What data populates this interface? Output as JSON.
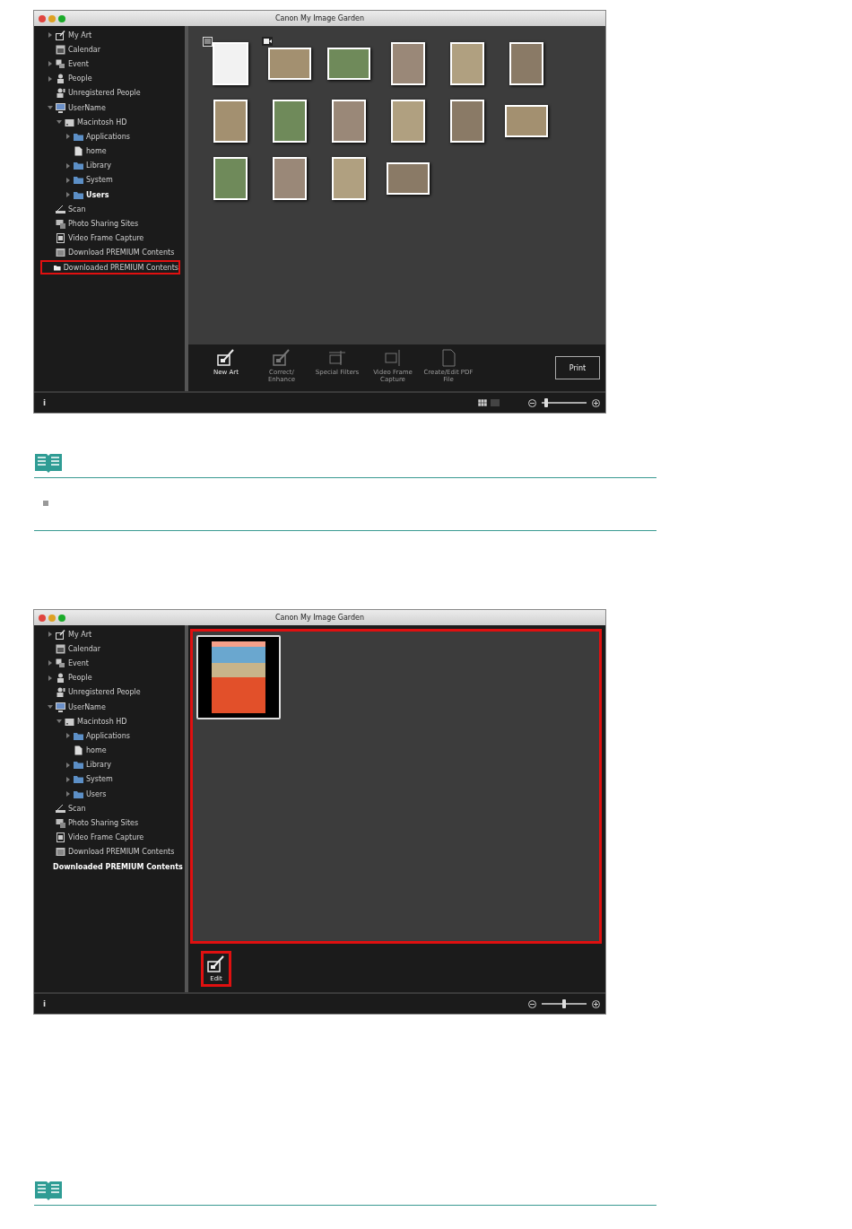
{
  "windows": [
    {
      "title": "Canon My Image Garden",
      "sidebar": {
        "items": [
          {
            "label": "My Art",
            "kind": "art",
            "expandable": true,
            "expanded": false,
            "selected": false,
            "highlighted": false
          },
          {
            "label": "Calendar",
            "kind": "calendar",
            "expandable": false,
            "selected": false,
            "highlighted": false
          },
          {
            "label": "Event",
            "kind": "event",
            "expandable": true,
            "expanded": false,
            "selected": false,
            "highlighted": false
          },
          {
            "label": "People",
            "kind": "people",
            "expandable": true,
            "expanded": false,
            "selected": false,
            "highlighted": false
          },
          {
            "label": "Unregistered People",
            "kind": "unregistered",
            "expandable": false,
            "selected": false,
            "highlighted": false
          },
          {
            "label": "UserName",
            "kind": "computer",
            "expandable": true,
            "expanded": true,
            "selected": false,
            "highlighted": false,
            "children": [
              {
                "label": "Macintosh HD",
                "kind": "disk",
                "expandable": true,
                "expanded": true,
                "selected": false,
                "highlighted": false,
                "children": [
                  {
                    "label": "Applications",
                    "kind": "folder",
                    "expandable": true,
                    "expanded": false,
                    "selected": false,
                    "highlighted": false
                  },
                  {
                    "label": "home",
                    "kind": "document",
                    "expandable": false,
                    "selected": false,
                    "highlighted": false
                  },
                  {
                    "label": "Library",
                    "kind": "folder",
                    "expandable": true,
                    "expanded": false,
                    "selected": false,
                    "highlighted": false
                  },
                  {
                    "label": "System",
                    "kind": "folder",
                    "expandable": true,
                    "expanded": false,
                    "selected": false,
                    "highlighted": false
                  },
                  {
                    "label": "Users",
                    "kind": "folder",
                    "expandable": true,
                    "expanded": false,
                    "selected": true,
                    "highlighted": false
                  }
                ]
              }
            ]
          },
          {
            "label": "Scan",
            "kind": "scan",
            "expandable": false,
            "selected": false,
            "highlighted": false
          },
          {
            "label": "Photo Sharing Sites",
            "kind": "sharing",
            "expandable": false,
            "selected": false,
            "highlighted": false
          },
          {
            "label": "Video Frame Capture",
            "kind": "video",
            "expandable": false,
            "selected": false,
            "highlighted": false
          },
          {
            "label": "Download PREMIUM Contents",
            "kind": "download",
            "expandable": false,
            "selected": false,
            "highlighted": false
          },
          {
            "label": "Downloaded PREMIUM Contents",
            "kind": "downloaded",
            "expandable": false,
            "selected": false,
            "highlighted": true
          }
        ]
      },
      "content": {
        "highlighted": false,
        "thumbnails": [
          {
            "kind": "document",
            "selected": false
          },
          {
            "kind": "video",
            "selected": false
          },
          {
            "kind": "wide",
            "selected": false
          },
          {
            "kind": "photo",
            "selected": false
          },
          {
            "kind": "photo",
            "selected": false
          },
          {
            "kind": "photo",
            "selected": false
          },
          {
            "kind": "photo",
            "selected": false
          },
          {
            "kind": "photo",
            "selected": false
          },
          {
            "kind": "photo",
            "selected": false
          },
          {
            "kind": "photo",
            "selected": false
          },
          {
            "kind": "photo",
            "selected": false
          },
          {
            "kind": "wide",
            "selected": false
          },
          {
            "kind": "photo",
            "selected": false
          },
          {
            "kind": "photo",
            "selected": false
          },
          {
            "kind": "photo",
            "selected": false
          },
          {
            "kind": "wide",
            "selected": false
          }
        ]
      },
      "toolbar": {
        "buttons": [
          {
            "label": "New Art",
            "kind": "art",
            "disabled": false,
            "highlighted": false
          },
          {
            "label": "Correct/ Enhance",
            "kind": "correct",
            "disabled": true,
            "highlighted": false
          },
          {
            "label": "Special Filters",
            "kind": "filters",
            "disabled": true,
            "highlighted": false
          },
          {
            "label": "Video Frame Capture",
            "kind": "video",
            "disabled": true,
            "highlighted": false
          },
          {
            "label": "Create/Edit PDF File",
            "kind": "pdf",
            "disabled": true,
            "highlighted": false
          }
        ],
        "print_button": "Print"
      },
      "status_bar": {
        "info": "i",
        "view_modes": [
          {
            "kind": "grid",
            "selected": true
          },
          {
            "kind": "single",
            "selected": false
          }
        ],
        "zoom": {
          "level": 0.1
        }
      }
    },
    {
      "title": "Canon My Image Garden",
      "sidebar": {
        "items": [
          {
            "label": "My Art",
            "kind": "art",
            "expandable": true,
            "expanded": false,
            "selected": false,
            "highlighted": false
          },
          {
            "label": "Calendar",
            "kind": "calendar",
            "expandable": false,
            "selected": false,
            "highlighted": false
          },
          {
            "label": "Event",
            "kind": "event",
            "expandable": true,
            "expanded": false,
            "selected": false,
            "highlighted": false
          },
          {
            "label": "People",
            "kind": "people",
            "expandable": true,
            "expanded": false,
            "selected": false,
            "highlighted": false
          },
          {
            "label": "Unregistered People",
            "kind": "unregistered",
            "expandable": false,
            "selected": false,
            "highlighted": false
          },
          {
            "label": "UserName",
            "kind": "computer",
            "expandable": true,
            "expanded": true,
            "selected": false,
            "highlighted": false,
            "children": [
              {
                "label": "Macintosh HD",
                "kind": "disk",
                "expandable": true,
                "expanded": true,
                "selected": false,
                "highlighted": false,
                "children": [
                  {
                    "label": "Applications",
                    "kind": "folder",
                    "expandable": true,
                    "expanded": false,
                    "selected": false,
                    "highlighted": false
                  },
                  {
                    "label": "home",
                    "kind": "document",
                    "expandable": false,
                    "selected": false,
                    "highlighted": false
                  },
                  {
                    "label": "Library",
                    "kind": "folder",
                    "expandable": true,
                    "expanded": false,
                    "selected": false,
                    "highlighted": false
                  },
                  {
                    "label": "System",
                    "kind": "folder",
                    "expandable": true,
                    "expanded": false,
                    "selected": false,
                    "highlighted": false
                  },
                  {
                    "label": "Users",
                    "kind": "folder",
                    "expandable": true,
                    "expanded": false,
                    "selected": false,
                    "highlighted": false
                  }
                ]
              }
            ]
          },
          {
            "label": "Scan",
            "kind": "scan",
            "expandable": false,
            "selected": false,
            "highlighted": false
          },
          {
            "label": "Photo Sharing Sites",
            "kind": "sharing",
            "expandable": false,
            "selected": false,
            "highlighted": false
          },
          {
            "label": "Video Frame Capture",
            "kind": "video",
            "expandable": false,
            "selected": false,
            "highlighted": false
          },
          {
            "label": "Download PREMIUM Contents",
            "kind": "download",
            "expandable": false,
            "selected": false,
            "highlighted": false
          },
          {
            "label": "Downloaded PREMIUM Contents",
            "kind": "downloaded",
            "expandable": false,
            "selected": true,
            "highlighted": false
          }
        ]
      },
      "content": {
        "highlighted": true,
        "thumbnails": [
          {
            "kind": "calendar",
            "selected": true
          }
        ]
      },
      "toolbar": {
        "buttons": [
          {
            "label": "Edit",
            "kind": "art",
            "disabled": false,
            "highlighted": true
          }
        ]
      },
      "status_bar": {
        "info": "i",
        "zoom": {
          "level": 0.5
        }
      }
    }
  ],
  "notes": [
    {
      "bullet": true
    },
    {
      "bullet": false
    }
  ]
}
